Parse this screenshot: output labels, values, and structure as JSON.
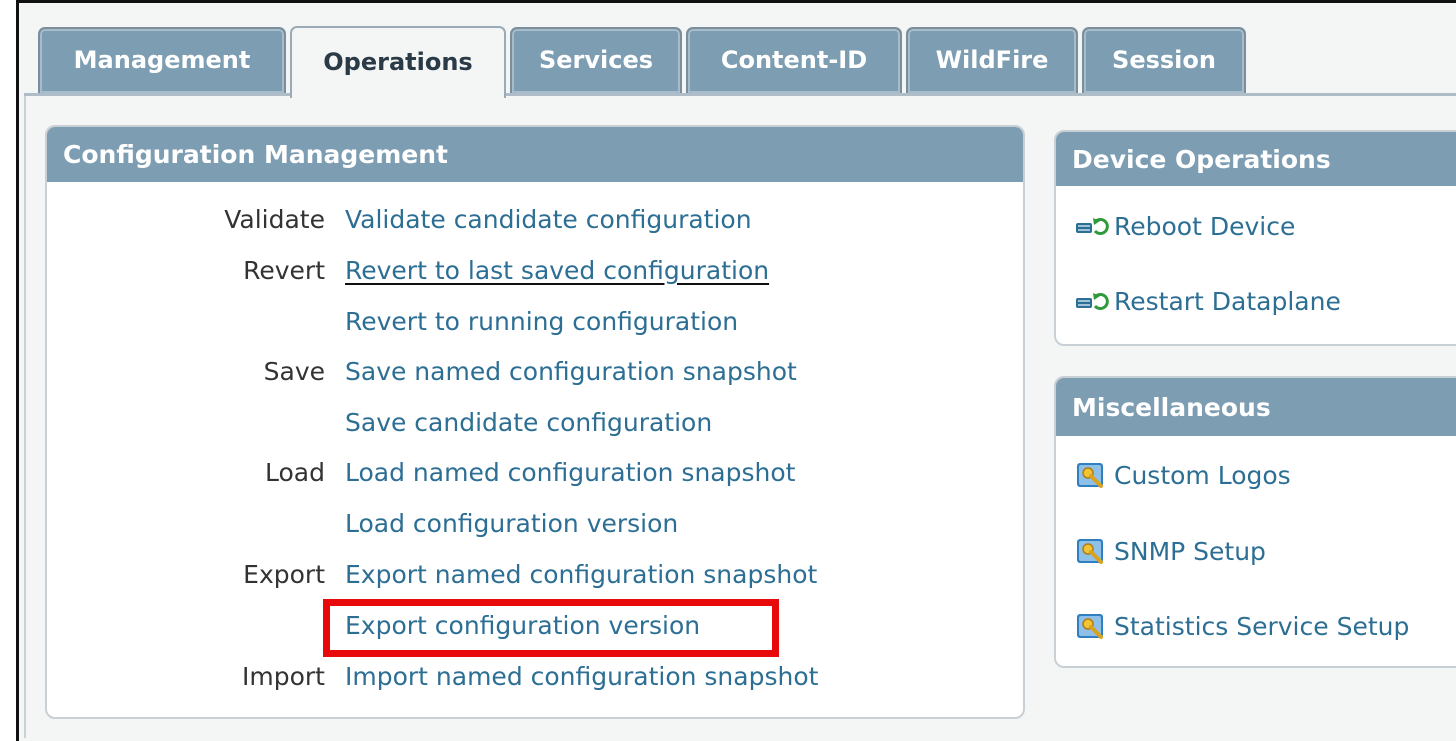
{
  "tabs": [
    {
      "label": "Management"
    },
    {
      "label": "Operations"
    },
    {
      "label": "Services"
    },
    {
      "label": "Content-ID"
    },
    {
      "label": "WildFire"
    },
    {
      "label": "Session"
    }
  ],
  "active_tab": "Operations",
  "config_management": {
    "title": "Configuration Management",
    "rows": [
      {
        "group": "Validate",
        "link": "Validate candidate configuration"
      },
      {
        "group": "Revert",
        "link": "Revert to last saved configuration"
      },
      {
        "group": "",
        "link": "Revert to running configuration"
      },
      {
        "group": "Save",
        "link": "Save named configuration snapshot"
      },
      {
        "group": "",
        "link": "Save candidate configuration"
      },
      {
        "group": "Load",
        "link": "Load named configuration snapshot"
      },
      {
        "group": "",
        "link": "Load configuration version"
      },
      {
        "group": "Export",
        "link": "Export named configuration snapshot"
      },
      {
        "group": "",
        "link": "Export configuration version"
      },
      {
        "group": "Import",
        "link": "Import named configuration snapshot"
      }
    ],
    "highlighted_link": "Export configuration version"
  },
  "device_operations": {
    "title": "Device Operations",
    "items": [
      {
        "label": "Reboot Device",
        "icon": "reboot-icon"
      },
      {
        "label": "Restart Dataplane",
        "icon": "restart-icon"
      }
    ]
  },
  "miscellaneous": {
    "title": "Miscellaneous",
    "items": [
      {
        "label": "Custom Logos",
        "icon": "settings-key-icon"
      },
      {
        "label": "SNMP Setup",
        "icon": "settings-key-icon"
      },
      {
        "label": "Statistics Service Setup",
        "icon": "settings-key-icon"
      }
    ]
  },
  "colors": {
    "header": "#7d9db2",
    "link": "#2d6f94",
    "highlight": "#e8090b"
  }
}
